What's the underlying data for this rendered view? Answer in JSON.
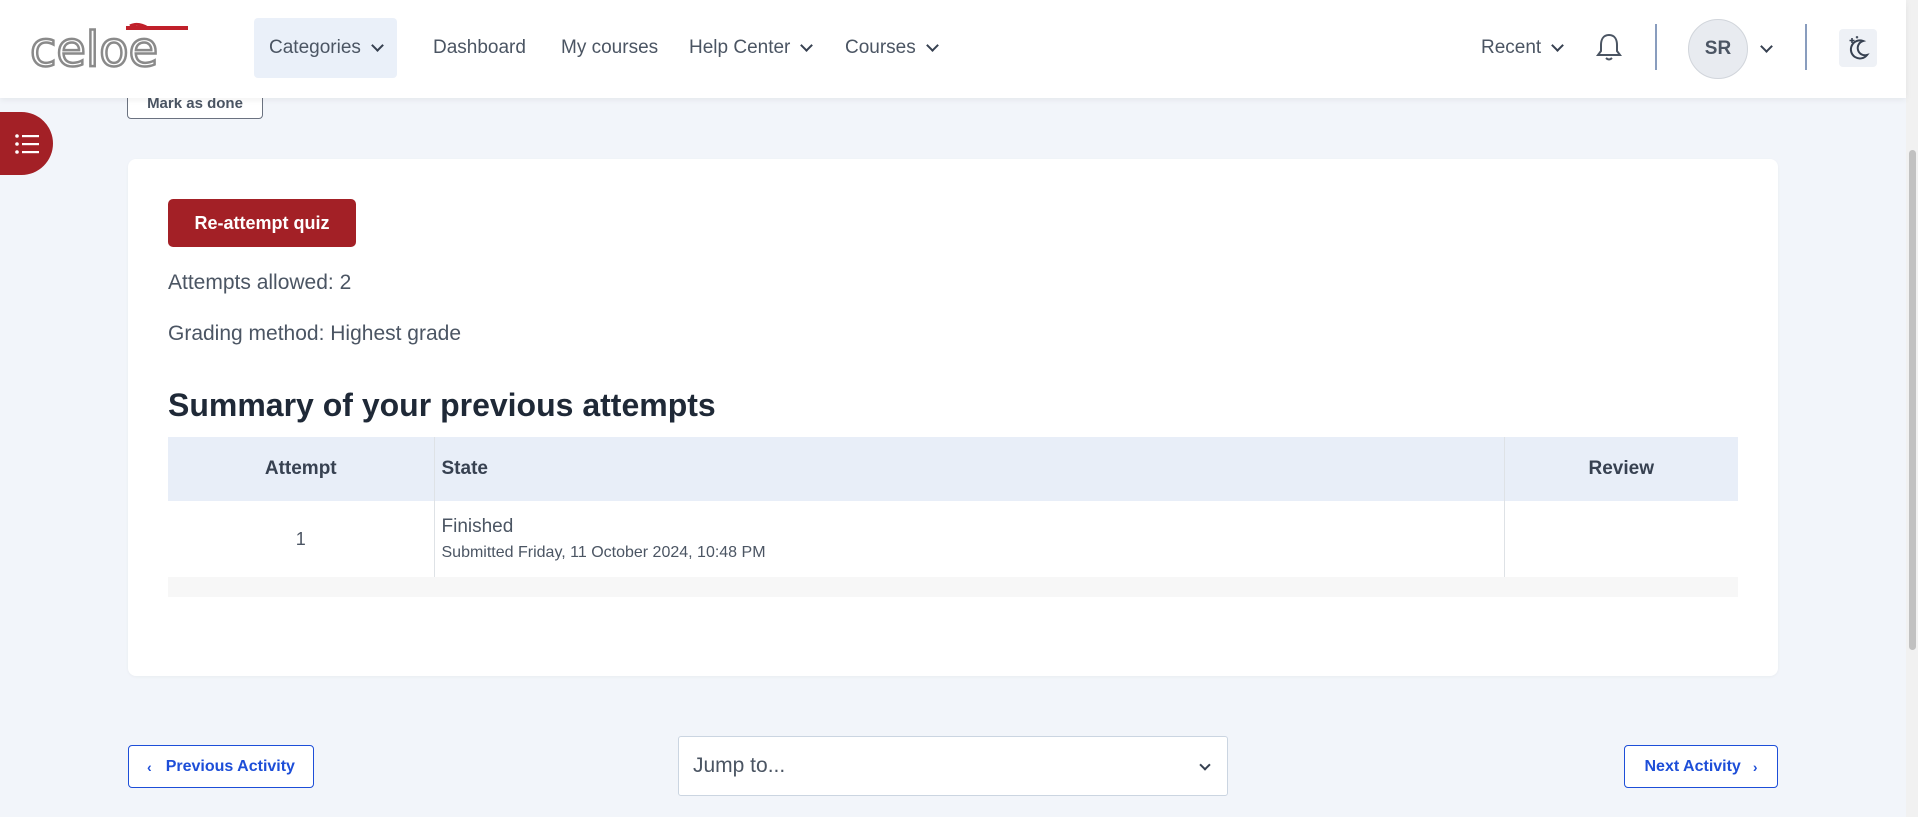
{
  "navbar": {
    "logo_text": "celoe",
    "items": [
      {
        "label": "Categories",
        "dropdown": true
      },
      {
        "label": "Dashboard",
        "dropdown": false
      },
      {
        "label": "My courses",
        "dropdown": false
      },
      {
        "label": "Help Center",
        "dropdown": true
      },
      {
        "label": "Courses",
        "dropdown": true
      }
    ],
    "recent_label": "Recent",
    "user_initials": "SR",
    "icons": [
      "bell-icon",
      "moon-stars-icon",
      "list-icon"
    ]
  },
  "page": {
    "mark_done_label": "Mark as done",
    "reattempt_label": "Re-attempt quiz",
    "attempts_allowed": "Attempts allowed: 2",
    "grading_method": "Grading method: Highest grade",
    "summary_title": "Summary of your previous attempts",
    "table": {
      "headers": [
        "Attempt",
        "State",
        "Review"
      ],
      "rows": [
        {
          "attempt": "1",
          "state": "Finished",
          "submitted": "Submitted Friday, 11 October 2024, 10:48 PM",
          "review": ""
        }
      ]
    }
  },
  "footer_nav": {
    "previous_label": "Previous Activity",
    "jump_placeholder": "Jump to...",
    "next_label": "Next Activity"
  },
  "colors": {
    "brand": "#a32026",
    "link": "#1d4ed8",
    "background": "#f2f5fa"
  }
}
